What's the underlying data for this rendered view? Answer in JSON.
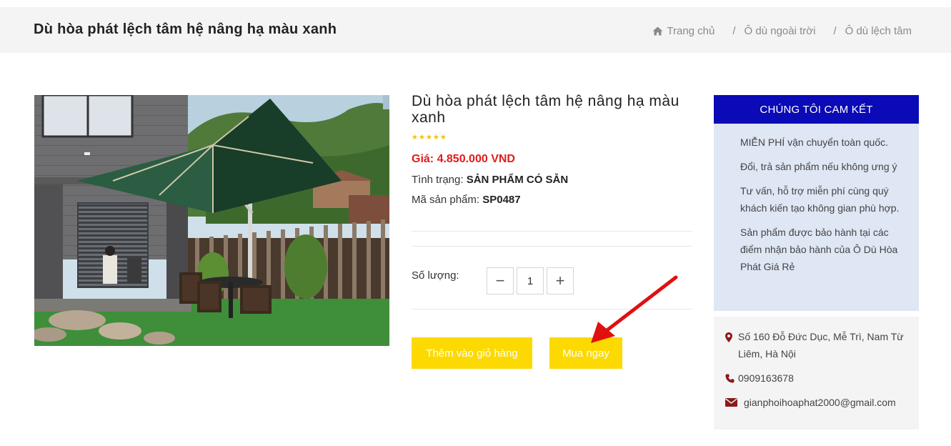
{
  "header": {
    "title": "Dù hòa phát lệch tâm hệ nâng hạ màu xanh",
    "breadcrumb": {
      "home": "Trang chủ",
      "separator": "/",
      "level1": "Ô dù ngoài trời",
      "level2": "Ô dù lệch tâm"
    }
  },
  "product": {
    "name": "Dù hòa phát lệch tâm hệ nâng hạ màu xanh",
    "rating_stars": 5,
    "price": "Giá: 4.850.000 VND",
    "status_label": "Tình trạng: ",
    "status_value": "SẢN PHẨM CÓ SẴN",
    "sku_label": "Mã sản phẩm: ",
    "sku_value": "SP0487",
    "quantity_label": "Số lượng:",
    "quantity_value": "1",
    "minus_symbol": "−",
    "plus_symbol": "+",
    "add_to_cart": "Thêm vào giỏ hàng",
    "buy_now": "Mua ngay"
  },
  "commitment": {
    "heading": "CHÚNG TÔI CAM KẾT",
    "items": [
      "MIỄN PHÍ vận chuyển toàn quốc.",
      "Đổi, trả sản phẩm nếu không ưng ý",
      "Tư vấn, hỗ trợ miễn phí cùng quý khách kiến tạo không gian phù hợp.",
      "Sản phẩm được bảo hành tại các điểm nhận bảo hành của Ô Dù Hòa Phát Giá Rẻ"
    ]
  },
  "contact": {
    "address": "Số 160 Đỗ Đức Dục, Mễ Trì, Nam Từ Liêm, Hà Nội",
    "phone": "0909163678",
    "email": "gianphoihoaphat2000@gmail.com"
  },
  "colors": {
    "accent_yellow": "#fcd900",
    "price_red": "#e31b1b",
    "commit_blue": "#0a0ab6",
    "commit_bg": "#dfe6f4",
    "icon_maroon": "#8b1a1a",
    "annotation_arrow": "#e01010"
  },
  "icons": {
    "home": "home-icon",
    "location": "map-marker-icon",
    "phone": "phone-icon",
    "email": "envelope-icon",
    "star": "star-icon"
  }
}
